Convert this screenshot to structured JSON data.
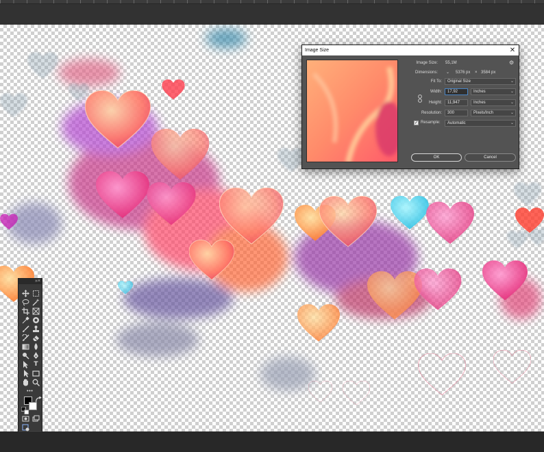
{
  "dialog": {
    "title": "Image Size",
    "image_size_label": "Image Size:",
    "image_size_value": "55,1M",
    "dimensions_label": "Dimensions:",
    "dim_width": "5376 px",
    "dim_sep": "×",
    "dim_height": "3584 px",
    "fit_to_label": "Fit To:",
    "fit_to_value": "Original Size",
    "width_label": "Width:",
    "width_value": "17,92",
    "width_unit": "Inches",
    "height_label": "Height:",
    "height_value": "11,947",
    "height_unit": "Inches",
    "resolution_label": "Resolution:",
    "resolution_value": "300",
    "resolution_unit": "Pixels/Inch",
    "resample_label": "Resample:",
    "resample_checked": true,
    "resample_value": "Automatic",
    "ok_label": "OK",
    "cancel_label": "Cancel",
    "close_glyph": "✕"
  },
  "tools_panel": {
    "collapse_glyph": "»",
    "close_glyph": "×",
    "tools": [
      "move-tool",
      "marquee-tool",
      "lasso-tool",
      "magic-wand-tool",
      "crop-tool",
      "frame-tool",
      "eyedropper-tool",
      "spot-healing-tool",
      "brush-tool",
      "clone-stamp-tool",
      "history-brush-tool",
      "eraser-tool",
      "gradient-tool",
      "blur-tool",
      "dodge-tool",
      "pen-tool",
      "type-tool",
      "path-selection-tool",
      "rectangle-tool",
      "hand-tool",
      "zoom-tool",
      "more-tools",
      "foreground-color",
      "background-color",
      "quick-mask",
      "screen-mode",
      "edit-toolbar"
    ],
    "type_glyph": "T",
    "more_glyph": "•••"
  },
  "colors": {
    "foreground": "#000000",
    "background": "#ffffff",
    "accent": "#4b86c5"
  }
}
